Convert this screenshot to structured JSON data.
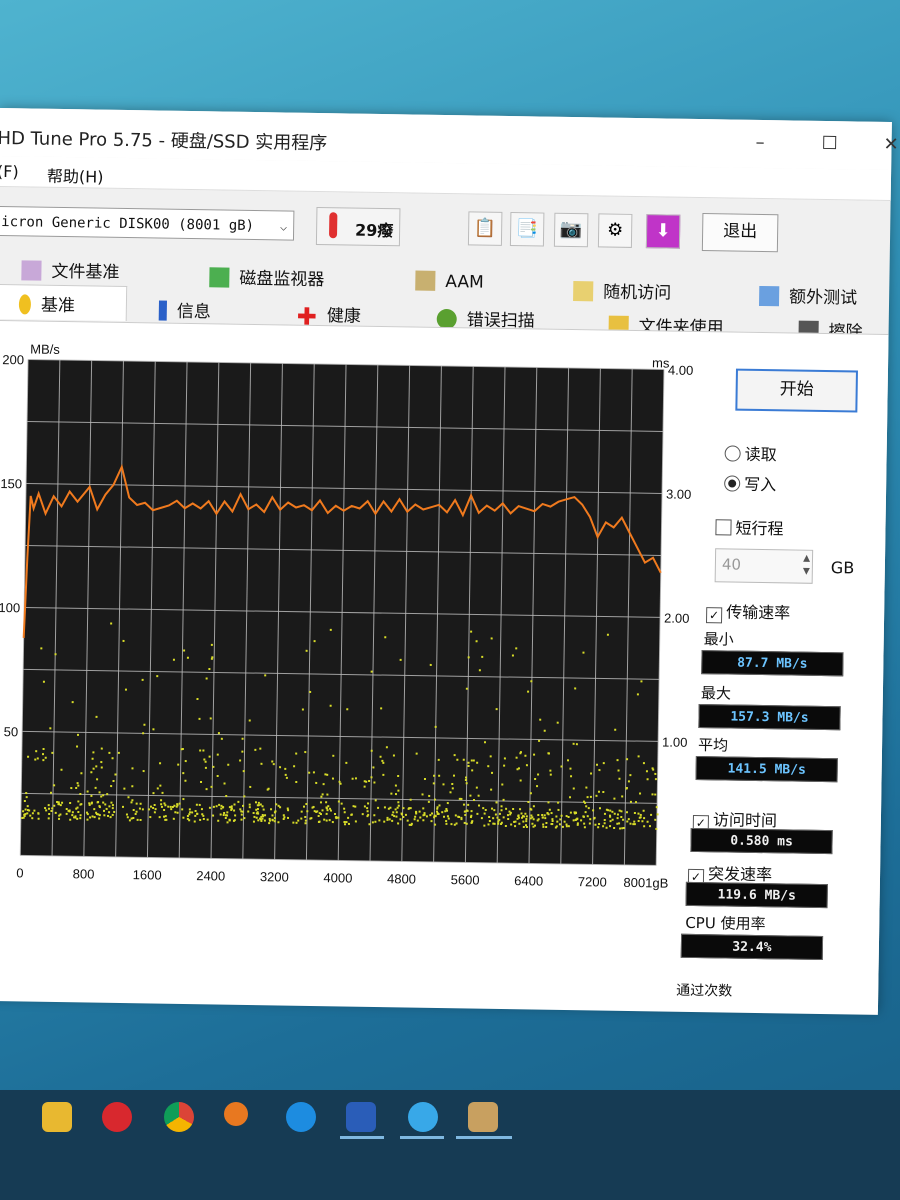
{
  "window": {
    "title": "HD Tune Pro 5.75 - 硬盘/SSD 实用程序",
    "minimize": "–",
    "maximize": "☐",
    "close": "✕"
  },
  "menu": {
    "file": "(F)",
    "help": "帮助(H)"
  },
  "toolbar": {
    "drive": "icron Generic DISK00 (8001 gB)",
    "temperature": "29癈",
    "exit_label": "退出"
  },
  "tabs": {
    "row1": [
      "文件基准",
      "磁盘监视器",
      "AAM",
      "随机访问",
      "额外测试"
    ],
    "row2": [
      "基准",
      "信息",
      "健康",
      "错误扫描",
      "文件夹使用",
      "擦除"
    ]
  },
  "colors": {
    "chart_bg": "#1a1a1a",
    "grid": "#b8b8b8",
    "transfer_line": "#f07a1e",
    "access_points": "#d8dc28"
  },
  "controls": {
    "start_label": "开始",
    "read_label": "读取",
    "write_label": "写入",
    "short_stroke_label": "短行程",
    "short_stroke_value": "40",
    "gb_unit": "GB",
    "transfer_rate_label": "传输速率",
    "min_label": "最小",
    "min_value": "87.7 MB/s",
    "max_label": "最大",
    "max_value": "157.3 MB/s",
    "avg_label": "平均",
    "avg_value": "141.5 MB/s",
    "access_time_label": "访问时间",
    "access_time_value": "0.580 ms",
    "burst_label": "突发速率",
    "burst_value": "119.6 MB/s",
    "cpu_label": "CPU 使用率",
    "cpu_value": "32.4%",
    "pass_label": "通过次数"
  },
  "chart_data": {
    "type": "line",
    "y_unit_left": "MB/s",
    "y_unit_right": "ms",
    "x_ticks": [
      "0",
      "800",
      "1600",
      "2400",
      "3200",
      "4000",
      "4800",
      "5600",
      "6400",
      "7200",
      "8001gB"
    ],
    "y_ticks_left": [
      "200",
      "150",
      "100",
      "50"
    ],
    "y_ticks_right": [
      "4.00",
      "3.00",
      "2.00",
      "1.00"
    ],
    "xlim": [
      0,
      8001
    ],
    "ylim_left": [
      0,
      200
    ],
    "ylim_right": [
      0,
      4
    ],
    "series": [
      {
        "kind": "transfer",
        "unit": "MB/s",
        "x": [
          0,
          30,
          60,
          100,
          160,
          250,
          350,
          450,
          550,
          650,
          800,
          900,
          1000,
          1100,
          1200,
          1300,
          1400,
          1500,
          1600,
          1700,
          1800,
          1900,
          2000,
          2100,
          2200,
          2300,
          2400,
          2500,
          2600,
          2700,
          2800,
          2900,
          3000,
          3100,
          3200,
          3300,
          3400,
          3500,
          3600,
          3700,
          3800,
          3900,
          4000,
          4100,
          4200,
          4300,
          4400,
          4500,
          4600,
          4700,
          4800,
          4900,
          5000,
          5100,
          5200,
          5300,
          5400,
          5500,
          5600,
          5700,
          5800,
          5900,
          6000,
          6100,
          6200,
          6300,
          6400,
          6500,
          6600,
          6700,
          6800,
          6900,
          7000,
          7100,
          7200,
          7300,
          7400,
          7500,
          7600,
          7700,
          7800,
          7900,
          8001
        ],
        "values": [
          87.7,
          120,
          145,
          140,
          146,
          138,
          145,
          141,
          147,
          143,
          149,
          140,
          146,
          150,
          157.3,
          145,
          142,
          143,
          140,
          141,
          142,
          144,
          141,
          143,
          141,
          144,
          139,
          144,
          140,
          147,
          141,
          143,
          140,
          146,
          141,
          144,
          142,
          143,
          141,
          145,
          140,
          143,
          141,
          143,
          142,
          145,
          140,
          145,
          141,
          146,
          141,
          144,
          142,
          143,
          144,
          141,
          146,
          140,
          148,
          141,
          144,
          142,
          145,
          141,
          144,
          143,
          142,
          145,
          144,
          146,
          147,
          148,
          145,
          140,
          132,
          138,
          136,
          140,
          134,
          128,
          122,
          124,
          118
        ]
      },
      {
        "kind": "access_time",
        "unit": "ms",
        "density": "scatter",
        "typical_range_ms": [
          0.3,
          0.9
        ],
        "outlier_max_ms": 1.9
      }
    ]
  },
  "taskbar": {
    "icons": [
      "file-explorer-icon",
      "netease-music-icon",
      "chrome-icon",
      "search-tool-icon",
      "edge-icon",
      "app-icon",
      "maxthon-icon",
      "hdtune-icon"
    ]
  }
}
